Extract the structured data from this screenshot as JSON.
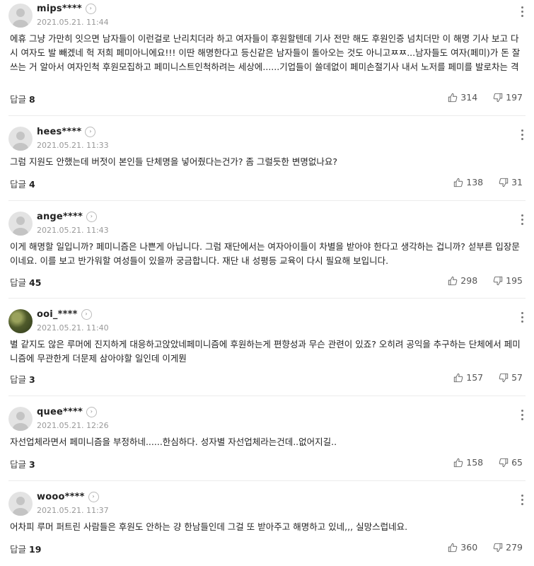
{
  "reply_label": "답글",
  "comments": [
    {
      "nickname": "mips****",
      "date": "2021.05.21. 11:44",
      "text": "에휴 그냥 가만히 잇으면 남자들이 이런걸로 난리치더라 하고 여자들이 후원할텐데 기사 전만 해도 후원인증 넘치더만 이 해명 기사 보고 다시 여자도 발 빼겠네 헉 저희 페미아니에요!!! 이딴 해명한다고 등신같은 남자들이 돌아오는 것도 아니고ㅉㅉ...남자들도 여자(페미)가 돈 잘 쓰는 거 알아서 여자인척 후원모집하고 페미니스트인척하려는 세상에......기업들이 쓸데없이 페미손절기사 내서 노저를 페미를 발로차는 격",
      "replies": "8",
      "likes": "314",
      "dislikes": "197"
    },
    {
      "nickname": "hees****",
      "date": "2021.05.21. 11:33",
      "text": "그럼 지원도 안했는데 버젓이 본인들 단체명을 넣어줬다는건가? 좀 그럴듯한 변명없나요?",
      "replies": "4",
      "likes": "138",
      "dislikes": "31"
    },
    {
      "nickname": "ange****",
      "date": "2021.05.21. 11:43",
      "text": "이게 해명할 일입니까? 페미니즘은 나쁜게 아닙니다. 그럼 재단에서는 여자아이들이 차별을 받아야 한다고 생각하는 겁니까? 섣부른 입장문이네요. 이를 보고 반가워할 여성들이 있을까 궁금합니다. 재단 내 성평등 교육이 다시 필요해 보입니다.",
      "replies": "45",
      "likes": "298",
      "dislikes": "195"
    },
    {
      "nickname": "ooi_****",
      "date": "2021.05.21. 11:40",
      "text": "별 같지도 않은 루머에 진지하게 대응하고앉았네페미니즘에 후원하는게 편향성과 무슨 관련이 있죠? 오히려 공익을 추구하는 단체에서 페미니즘에 무관한게 더문제 삼아야할 일인데 이게뭔",
      "replies": "3",
      "likes": "157",
      "dislikes": "57"
    },
    {
      "nickname": "quee****",
      "date": "2021.05.21. 12:26",
      "text": "자선업체라면서 페미니즘을 부정하네......한심하다. 성자별 자선업체라는건데..없어지길..",
      "replies": "3",
      "likes": "158",
      "dislikes": "65"
    },
    {
      "nickname": "wooo****",
      "date": "2021.05.21. 11:37",
      "text": "어차피 루머 퍼트린 사람들은 후원도 안하는 걍 한남들인데 그걸 또 받아주고 해명하고 있네,,, 실망스럽네요.",
      "replies": "19",
      "likes": "360",
      "dislikes": "279"
    }
  ]
}
